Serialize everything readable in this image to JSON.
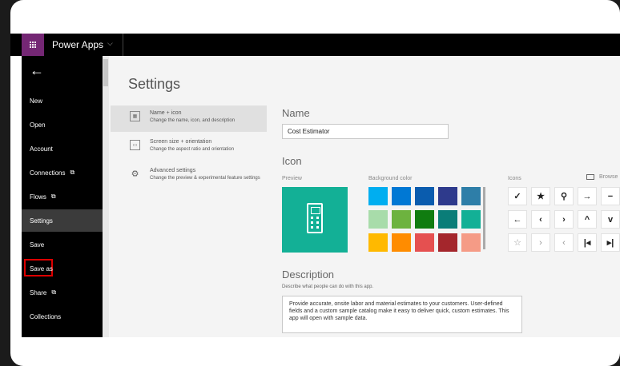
{
  "header": {
    "app_title": "Power Apps",
    "chevron": "⌵"
  },
  "sidebar": {
    "back": "←",
    "items": [
      {
        "label": "New"
      },
      {
        "label": "Open"
      },
      {
        "label": "Account"
      },
      {
        "label": "Connections",
        "ext": "⧉"
      },
      {
        "label": "Flows",
        "ext": "⧉"
      },
      {
        "label": "Settings"
      },
      {
        "label": "Save"
      },
      {
        "label": "Save as"
      },
      {
        "label": "Share",
        "ext": "⧉"
      },
      {
        "label": "Collections"
      }
    ]
  },
  "page": {
    "title": "Settings"
  },
  "settings_menu": [
    {
      "title": "Name + icon",
      "subtitle": "Change the name, icon, and description",
      "icon": "▦"
    },
    {
      "title": "Screen size + orientation",
      "subtitle": "Change the aspect ratio and orientation",
      "icon": "▭"
    },
    {
      "title": "Advanced settings",
      "subtitle": "Change the preview & experimental feature settings",
      "icon": "⚙"
    }
  ],
  "name_section": {
    "heading": "Name",
    "value": "Cost Estimator"
  },
  "icon_section": {
    "heading": "Icon",
    "preview_label": "Preview",
    "preview_color": "#13b096",
    "background_label": "Background color",
    "icons_label": "Icons",
    "browse_label": "Browse",
    "swatches": [
      [
        "#00aef0",
        "#0078d4",
        "#0a5cae",
        "#2e3a8c",
        "#2e7ea8"
      ],
      [
        "#a8dcaa",
        "#6db33f",
        "#107c10",
        "#0a7d78",
        "#13b096"
      ],
      [
        "#ffb900",
        "#ff8c00",
        "#e55050",
        "#a4262c",
        "#f59b86"
      ]
    ],
    "icon_grid": [
      [
        "✓",
        "★",
        "⚲",
        "→",
        "−"
      ],
      [
        "←",
        "‹",
        "›",
        "^",
        "v"
      ],
      [
        "☆",
        "›",
        "‹",
        "|◂",
        "▸|"
      ]
    ]
  },
  "description_section": {
    "heading": "Description",
    "hint": "Describe what people can do with this app.",
    "text": "Provide accurate, onsite labor and material estimates to your customers. User-defined fields and a custom sample catalog make it easy to deliver quick, custom estimates. This app will open with sample data."
  }
}
